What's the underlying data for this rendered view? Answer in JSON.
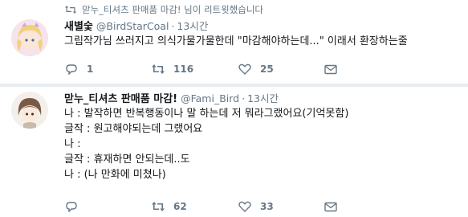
{
  "retweet_banner": {
    "text": "맏누_티셔츠 판매품 마감! 님이 리트윗했습니다"
  },
  "tweets": [
    {
      "display_name": "새별숯",
      "handle": "@BirdStarCoal",
      "time": "13시간",
      "lines": [
        "그림작가님 쓰러지고 의식가물가물한데 \"마감해야하는데...\" 이래서 환장하는줄"
      ],
      "reply_count": "1",
      "retweet_count": "116",
      "like_count": "25"
    },
    {
      "display_name": "맏누_티셔츠 판매품 마감!",
      "handle": "@Fami_Bird",
      "time": "13시간",
      "lines": [
        "나 : 발작하면 반복행동이나 말 하는데 저 뭐라그랬어요(기억못함)",
        "글작 : 원고해야되는데 그랬어요",
        "나 :",
        "글작 : 휴재하면 안되는데..도",
        "나 : (나 만화에 미쳤나)"
      ],
      "reply_count": "",
      "retweet_count": "62",
      "like_count": "33"
    }
  ],
  "colors": {
    "muted": "#657786",
    "text": "#14171a",
    "divider": "#e6ecf0",
    "retweet_green": "#17bf63"
  },
  "icons": [
    "retweet-icon",
    "reply-icon",
    "retweet-icon",
    "like-icon",
    "mail-icon"
  ]
}
